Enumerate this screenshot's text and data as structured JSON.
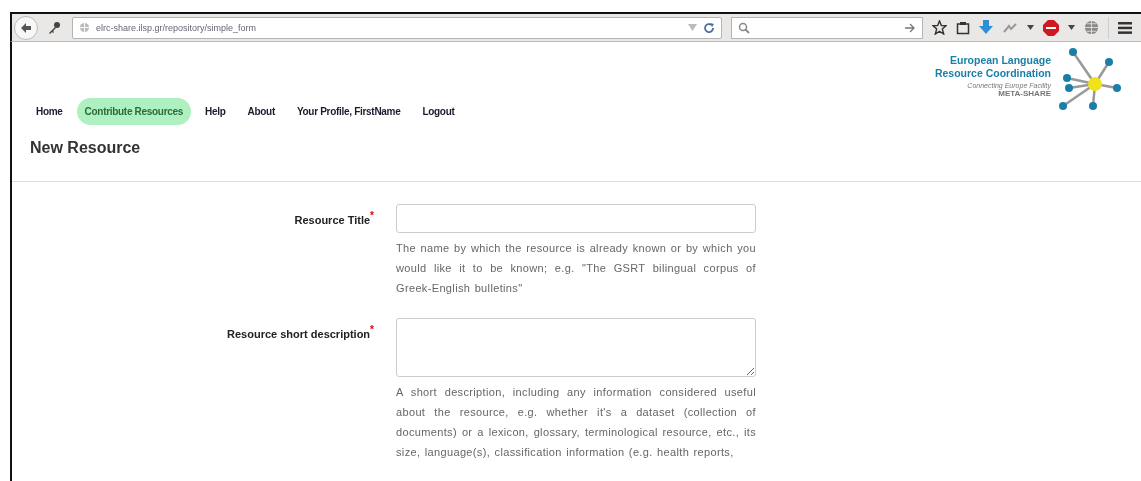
{
  "browser": {
    "url": "elrc-share.ilsp.gr/repository/simple_form"
  },
  "nav": [
    {
      "label": "Home",
      "selected": false
    },
    {
      "label": "Contribute Resources",
      "selected": true
    },
    {
      "label": "Help",
      "selected": false
    },
    {
      "label": "About",
      "selected": false
    },
    {
      "label": "Your Profile, FirstName",
      "selected": false
    },
    {
      "label": "Logout",
      "selected": false
    }
  ],
  "logo": {
    "line1": "European Language",
    "line2": "Resource Coordination",
    "tagline": "Connecting Europe Facility",
    "brand": "META-SHARE"
  },
  "page_title": "New Resource",
  "fields": [
    {
      "label": "Resource Title",
      "marker": "*",
      "kind": "input",
      "help": "The name by which the resource is already known or by which you would like it to be known; e.g. \"The GSRT bilingual corpus of Greek-English bulletins\""
    },
    {
      "label": "Resource short description",
      "marker": "*",
      "kind": "textarea",
      "help": "A short description, including any information considered useful about the resource, e.g. whether it's a dataset (collection of documents) or a lexicon, glossary, terminological resource, etc., its size, language(s), classification information (e.g. health reports,"
    }
  ]
}
